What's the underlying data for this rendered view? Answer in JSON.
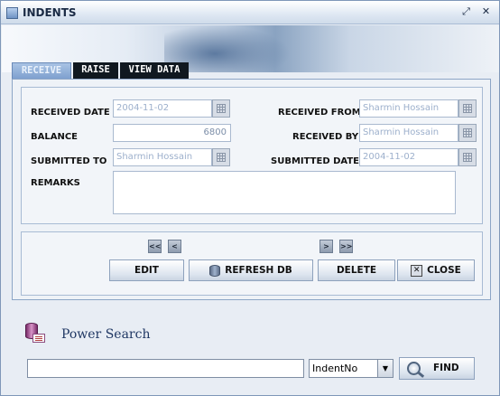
{
  "window": {
    "title": "INDENTS",
    "maximize_icon": "restore-icon",
    "close_icon": "close-icon"
  },
  "tabs": [
    {
      "label": "RECEIVE",
      "active": true
    },
    {
      "label": "RAISE",
      "active": false
    },
    {
      "label": "VIEW DATA",
      "active": false
    }
  ],
  "form": {
    "received_date": {
      "label": "RECEIVED DATE",
      "value": "2004-11-02"
    },
    "balance": {
      "label": "BALANCE",
      "value": "6800"
    },
    "submitted_to": {
      "label": "SUBMITTED TO",
      "value": "Sharmin Hossain"
    },
    "remarks": {
      "label": "REMARKS",
      "value": ""
    },
    "received_from": {
      "label": "RECEIVED FROM",
      "value": "Sharmin Hossain"
    },
    "received_by": {
      "label": "RECEIVED BY",
      "value": "Sharmin Hossain"
    },
    "submitted_date": {
      "label": "SUBMITTED DATE",
      "value": "2004-11-02"
    }
  },
  "navigation": {
    "first": "<<",
    "prev": "<",
    "next": ">",
    "last": ">>"
  },
  "actions": {
    "edit": "EDIT",
    "refresh": "REFRESH DB",
    "delete": "DELETE",
    "close": "CLOSE"
  },
  "power_search": {
    "title": "Power Search",
    "query": "",
    "field_selected": "IndentNo",
    "find_label": "FIND"
  },
  "colors": {
    "accent": "#7ea0cf",
    "tab_inactive": "#101820",
    "field_text": "#9db0cc"
  }
}
